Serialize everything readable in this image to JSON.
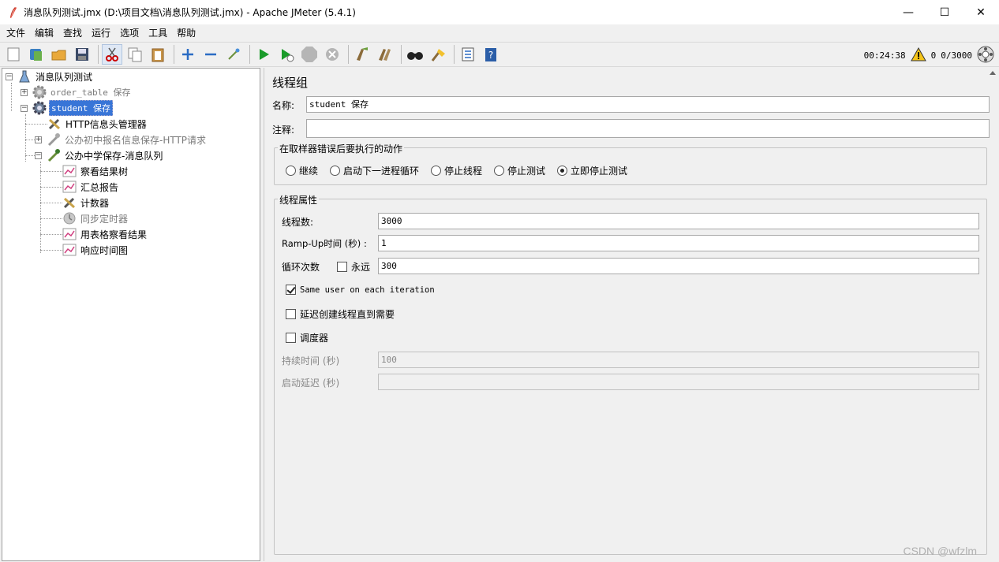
{
  "window": {
    "title": "消息队列测试.jmx (D:\\项目文档\\消息队列测试.jmx) - Apache JMeter (5.4.1)",
    "minimize": "—",
    "maximize": "☐",
    "close": "✕"
  },
  "menu": [
    "文件",
    "编辑",
    "查找",
    "运行",
    "选项",
    "工具",
    "帮助"
  ],
  "toolbar": {
    "elapsed_time": "00:24:38",
    "error_count": "0",
    "threads": "0/3000"
  },
  "tree": {
    "root": "消息队列测试",
    "items": [
      {
        "label": "order_table 保存",
        "disabled": true
      },
      {
        "label": "student 保存",
        "selected": true
      },
      {
        "label": "HTTP信息头管理器"
      },
      {
        "label": "公办初中报名信息保存-HTTP请求",
        "disabled": true
      },
      {
        "label": "公办中学保存-消息队列"
      },
      {
        "label": "察看结果树"
      },
      {
        "label": "汇总报告"
      },
      {
        "label": "计数器"
      },
      {
        "label": "同步定时器",
        "disabled": true
      },
      {
        "label": "用表格察看结果"
      },
      {
        "label": "响应时间图"
      }
    ]
  },
  "panel": {
    "title": "线程组",
    "name_label": "名称:",
    "name_value": "student 保存",
    "comment_label": "注释:",
    "comment_value": "",
    "error_group_title": "在取样器错误后要执行的动作",
    "error_actions": [
      {
        "label": "继续",
        "checked": false
      },
      {
        "label": "启动下一进程循环",
        "checked": false
      },
      {
        "label": "停止线程",
        "checked": false
      },
      {
        "label": "停止测试",
        "checked": false
      },
      {
        "label": "立即停止测试",
        "checked": true
      }
    ],
    "thread_group_title": "线程属性",
    "threads_label": "线程数:",
    "threads_value": "3000",
    "rampup_label": "Ramp-Up时间 (秒) :",
    "rampup_value": "1",
    "loop_label": "循环次数",
    "forever_label": "永远",
    "forever_checked": false,
    "loop_value": "300",
    "same_user_label": "Same user on each iteration",
    "same_user_checked": true,
    "delay_label": "延迟创建线程直到需要",
    "delay_checked": false,
    "scheduler_label": "调度器",
    "scheduler_checked": false,
    "duration_label": "持续时间 (秒)",
    "duration_value": "100",
    "startup_delay_label": "启动延迟 (秒)",
    "startup_delay_value": ""
  },
  "watermark": "CSDN @wfzlm"
}
